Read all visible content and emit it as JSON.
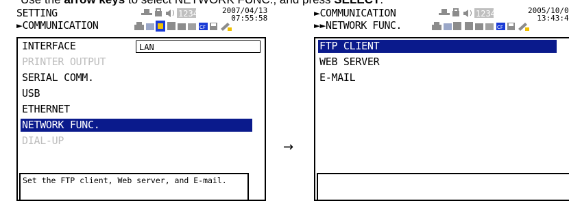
{
  "instruction": {
    "prefix": "Use the ",
    "bold_1": "arrow keys",
    "middle": " to select NETWORK FUNC., and press ",
    "bold_2": "SELECT",
    "suffix": "."
  },
  "arrow_glyph": "→",
  "left_screen": {
    "title_line1": "SETTING",
    "title_line2": "►COMMUNICATION",
    "date": "2007/04/13",
    "time": "07:55:58",
    "status_indicator": "1234",
    "interface_label": "INTERFACE",
    "interface_value": "LAN",
    "menu": [
      {
        "label": "INTERFACE",
        "state": "normal"
      },
      {
        "label": "PRINTER OUTPUT",
        "state": "disabled"
      },
      {
        "label": "SERIAL COMM.",
        "state": "normal"
      },
      {
        "label": "USB",
        "state": "normal"
      },
      {
        "label": "ETHERNET",
        "state": "normal"
      },
      {
        "label": "NETWORK FUNC.",
        "state": "selected"
      },
      {
        "label": "DIAL-UP",
        "state": "disabled"
      }
    ],
    "help_text": "Set the FTP client, Web server, and E-mail."
  },
  "right_screen": {
    "title_line1": "►COMMUNICATION",
    "title_line2": "►►NETWORK FUNC.",
    "date": "2005/10/0",
    "time": "13:43:4",
    "status_indicator": "1234",
    "menu": [
      {
        "label": "FTP CLIENT",
        "state": "selected"
      },
      {
        "label": "WEB SERVER",
        "state": "normal"
      },
      {
        "label": "E-MAIL",
        "state": "normal"
      }
    ],
    "help_text": ""
  },
  "colors": {
    "selection": "#0a1a8c",
    "disabled_text": "#bdbdbd",
    "icon_blue": "#1a3bd6",
    "icon_gray": "#8c8c8c"
  },
  "icons": [
    "network-icon",
    "lock-icon",
    "speaker-icon",
    "counter-icon",
    "usb-icon",
    "cf-card-icon",
    "floppy-icon",
    "tools-icon"
  ]
}
